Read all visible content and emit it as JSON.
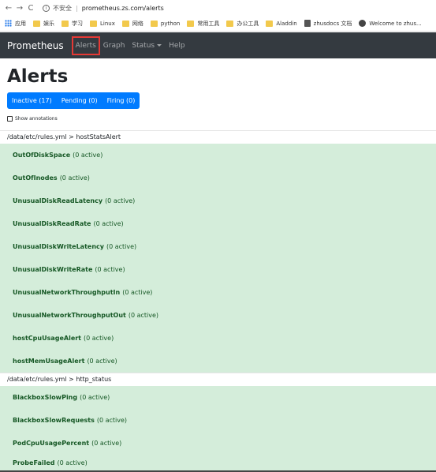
{
  "browser": {
    "insecure_label": "不安全",
    "url": "prometheus.zs.com/alerts",
    "bookmarks": [
      "应用",
      "娱乐",
      "学习",
      "Linux",
      "网络",
      "python",
      "常用工具",
      "办公工具",
      "Aladdin",
      "zhusdocs 文档",
      "Welcome to zhus..."
    ]
  },
  "navbar": {
    "brand": "Prometheus",
    "alerts": "Alerts",
    "graph": "Graph",
    "status": "Status",
    "help": "Help"
  },
  "page": {
    "title": "Alerts",
    "inactive": "Inactive (17)",
    "pending": "Pending (0)",
    "firing": "Firing (0)",
    "show_annotations": "Show annotations"
  },
  "groups": [
    {
      "header": "/data/etc/rules.yml > hostStatsAlert",
      "alerts": [
        {
          "name": "OutOfDiskSpace",
          "count": "(0 active)"
        },
        {
          "name": "OutOfInodes",
          "count": "(0 active)"
        },
        {
          "name": "UnusualDiskReadLatency",
          "count": "(0 active)"
        },
        {
          "name": "UnusualDiskReadRate",
          "count": "(0 active)"
        },
        {
          "name": "UnusualDiskWriteLatency",
          "count": "(0 active)"
        },
        {
          "name": "UnusualDiskWriteRate",
          "count": "(0 active)"
        },
        {
          "name": "UnusualNetworkThroughputIn",
          "count": "(0 active)"
        },
        {
          "name": "UnusualNetworkThroughputOut",
          "count": "(0 active)"
        },
        {
          "name": "hostCpuUsageAlert",
          "count": "(0 active)"
        },
        {
          "name": "hostMemUsageAlert",
          "count": "(0 active)"
        }
      ]
    },
    {
      "header": "/data/etc/rules.yml > http_status",
      "alerts": [
        {
          "name": "BlackboxSlowPing",
          "count": "(0 active)"
        },
        {
          "name": "BlackboxSlowRequests",
          "count": "(0 active)"
        },
        {
          "name": "PodCpuUsagePercent",
          "count": "(0 active)"
        },
        {
          "name": "ProbeFailed",
          "count": "(0 active)"
        }
      ]
    }
  ]
}
